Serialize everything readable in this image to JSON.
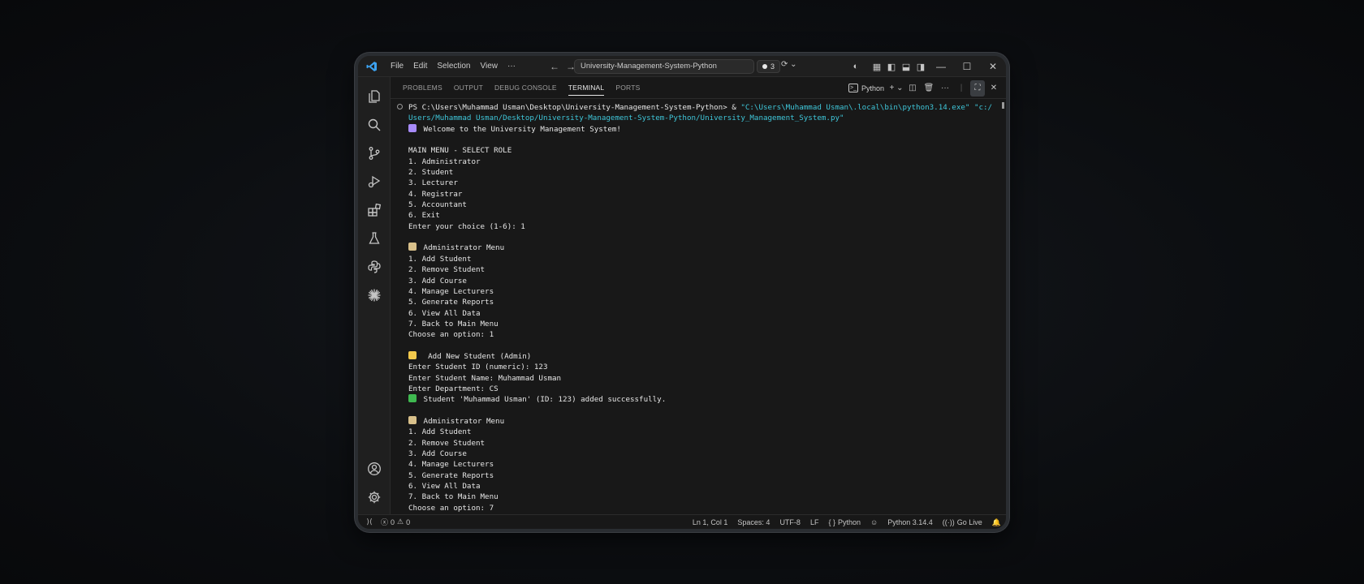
{
  "titlebar": {
    "menu": [
      "File",
      "Edit",
      "Selection",
      "View",
      "···"
    ],
    "search_text": "University-Management-System-Python",
    "badge_count": "3"
  },
  "panel": {
    "tabs": [
      "PROBLEMS",
      "OUTPUT",
      "DEBUG CONSOLE",
      "TERMINAL",
      "PORTS"
    ],
    "active_tab": "TERMINAL",
    "shell_label": "Python"
  },
  "terminal": {
    "command_prefix": "PS C:\\Users\\Muhammad Usman\\Desktop\\University-Management-System-Python> & ",
    "command_exe": "\"C:\\Users\\Muhammad Usman\\.local\\bin\\python3.14.exe\" \"c:/",
    "command_script": "Users/Muhammad Usman/Desktop/University-Management-System-Python/University_Management_System.py\"",
    "lines": [
      " Welcome to the University Management System!",
      "",
      "MAIN MENU - SELECT ROLE",
      "1. Administrator",
      "2. Student",
      "3. Lecturer",
      "4. Registrar",
      "5. Accountant",
      "6. Exit",
      "Enter your choice (1-6): 1",
      "",
      " Administrator Menu",
      "1. Add Student",
      "2. Remove Student",
      "3. Add Course",
      "4. Manage Lecturers",
      "5. Generate Reports",
      "6. View All Data",
      "7. Back to Main Menu",
      "Choose an option: 1",
      "",
      "  Add New Student (Admin)",
      "Enter Student ID (numeric): 123",
      "Enter Student Name: Muhammad Usman",
      "Enter Department: CS",
      " Student 'Muhammad Usman' (ID: 123) added successfully.",
      "",
      " Administrator Menu",
      "1. Add Student",
      "2. Remove Student",
      "3. Add Course",
      "4. Manage Lecturers",
      "5. Generate Reports",
      "6. View All Data",
      "7. Back to Main Menu",
      "Choose an option: 7"
    ]
  },
  "statusbar": {
    "errors": "0",
    "warnings": "0",
    "position": "Ln 1, Col 1",
    "spaces": "Spaces: 4",
    "encoding": "UTF-8",
    "eol": "LF",
    "language": "Python",
    "interpreter": "Python 3.14.4",
    "go_live": "Go Live"
  },
  "colors": {
    "accent_blue": "#3ca2f0",
    "path_cyan": "#3fc6d9",
    "check_green": "#3fb950"
  }
}
